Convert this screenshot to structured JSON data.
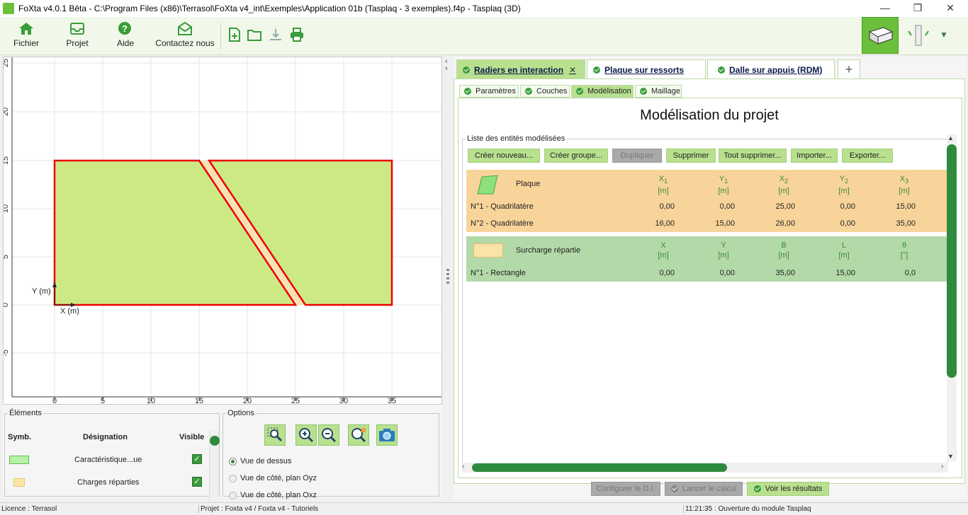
{
  "window": {
    "title": "FoXta v4.0.1 Bêta - C:\\Program Files (x86)\\Terrasol\\FoXta v4_int\\Exemples\\Application 01b (Tasplaq - 3 exemples).f4p - Tasplaq (3D)",
    "minimize": "—",
    "restore": "❐",
    "close": "✕"
  },
  "toolbar": {
    "fichier": "Fichier",
    "projet": "Projet",
    "aide": "Aide",
    "contact": "Contactez nous"
  },
  "canvas": {
    "x_axis_label": "X (m)",
    "y_axis_label": "Y (m)",
    "x_ticks": [
      "0",
      "5",
      "10",
      "15",
      "20",
      "25",
      "30",
      "35"
    ],
    "y_ticks": [
      "25",
      "20",
      "15",
      "10",
      "5",
      "0",
      "-5"
    ]
  },
  "elements_panel": {
    "legend": "Éléments",
    "col_symb": "Symb.",
    "col_designation": "Désignation",
    "col_visible": "Visible",
    "rows": [
      {
        "designation": "Caractéristique...ue"
      },
      {
        "designation": "Charges réparties"
      }
    ]
  },
  "options_panel": {
    "legend": "Options",
    "radios": [
      {
        "label": "Vue de dessus",
        "selected": true
      },
      {
        "label": "Vue de côté, plan Oyz",
        "selected": false
      },
      {
        "label": "Vue de côté, plan Oxz",
        "selected": false
      }
    ]
  },
  "tabs": {
    "main": [
      {
        "label": "Radiers en interaction",
        "close": "✕"
      },
      {
        "label": "Plaque sur ressorts"
      },
      {
        "label": "Dalle sur appuis (RDM)"
      }
    ],
    "add": "+",
    "sub": [
      "Paramètres",
      "Couches",
      "Modélisation",
      "Maillage"
    ]
  },
  "modelisation": {
    "title": "Modélisation du projet",
    "list_legend": "Liste des entités modélisées",
    "buttons": [
      "Créer nouveau...",
      "Créer groupe...",
      "Dupliquer",
      "Supprimer",
      "Tout supprimer...",
      "Importer...",
      "Exporter..."
    ],
    "plaque": {
      "label": "Plaque",
      "headers": [
        {
          "name": "X",
          "sub": "1",
          "unit": "[m]"
        },
        {
          "name": "Y",
          "sub": "1",
          "unit": "[m]"
        },
        {
          "name": "X",
          "sub": "2",
          "unit": "[m]"
        },
        {
          "name": "Y",
          "sub": "2",
          "unit": "[m]"
        },
        {
          "name": "X",
          "sub": "3",
          "unit": "[m]"
        }
      ],
      "rows": [
        {
          "name": "N°1 - Quadrilatère",
          "values": [
            "0,00",
            "0,00",
            "25,00",
            "0,00",
            "15,00"
          ]
        },
        {
          "name": "N°2 - Quadrilatère",
          "values": [
            "16,00",
            "15,00",
            "26,00",
            "0,00",
            "35,00"
          ]
        }
      ]
    },
    "surcharge": {
      "label": "Surcharge répartie",
      "headers": [
        {
          "name": "X",
          "unit": "[m]"
        },
        {
          "name": "Y",
          "unit": "[m]"
        },
        {
          "name": "B",
          "unit": "[m]"
        },
        {
          "name": "L",
          "unit": "[m]"
        },
        {
          "name": "θ",
          "unit": "[°]"
        }
      ],
      "rows": [
        {
          "name": "N°1 - Rectangle",
          "values": [
            "0,00",
            "0,00",
            "35,00",
            "15,00",
            "0,0"
          ]
        }
      ]
    }
  },
  "footer_buttons": {
    "configurer": "Configurer le D.I.",
    "lancer": "Lancer le calcul",
    "voir": "Voir les résultats"
  },
  "status": {
    "licence": "Licence : Terrasol",
    "projet": "Projet : Foxta v4 / Foxta v4 - Tutoriels",
    "message": "11:21:35 : Ouverture du module Tasplaq"
  }
}
